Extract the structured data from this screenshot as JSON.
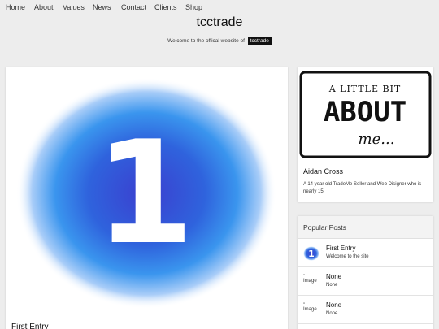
{
  "nav": {
    "items": [
      "Home",
      "About",
      "Values",
      "News",
      "Contact",
      "Clients",
      "Shop"
    ]
  },
  "site": {
    "title": "tcctrade",
    "tagline": "Welcome to the offical website of",
    "tagline_badge": "tcctrade"
  },
  "main": {
    "hero_number": "1",
    "post_title": "First Entry"
  },
  "about": {
    "image_text_line1": "A LITTLE BIT",
    "image_text_line2": "ABOUT",
    "image_text_line3": "me...",
    "name": "Aidan Cross",
    "description": "A 14 year old TradeMe Seller and Web Disigner who is nearly 15"
  },
  "popular": {
    "heading": "Popular Posts",
    "posts": [
      {
        "thumb_number": "1",
        "title": "First Entry",
        "subtitle": "Welcome to the site"
      },
      {
        "thumb_alt": "Image",
        "title": "None",
        "subtitle": "None"
      },
      {
        "thumb_alt": "Image",
        "title": "None",
        "subtitle": "None"
      }
    ]
  },
  "colors": {
    "background": "#ededed",
    "card": "#ffffff",
    "hero_blue": "#2a5fd8",
    "badge": "#111111"
  }
}
